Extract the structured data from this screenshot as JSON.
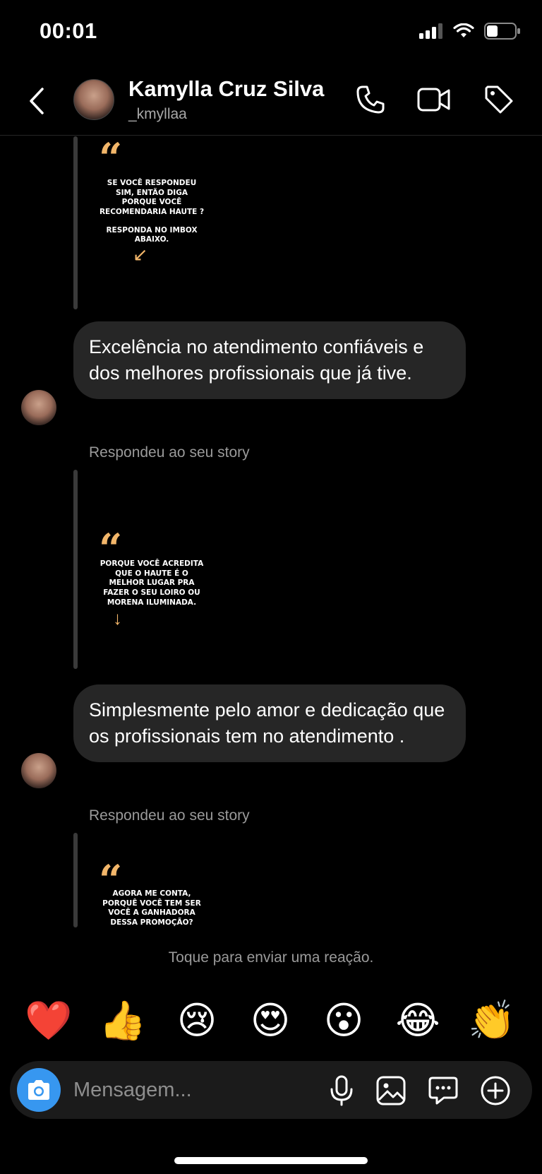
{
  "status_bar": {
    "time": "00:01",
    "battery_level": 0.35
  },
  "header": {
    "name": "Kamylla Cruz Silva",
    "username": "_kmyllaa"
  },
  "thread": {
    "story1": {
      "quote": "“",
      "text": "SE VOCÊ RESPONDEU SIM, ENTÃO DIGA PORQUE VOCÊ RECOMENDARIA HAUTE ?",
      "text2": "RESPONDA NO IMBOX ABAIXO."
    },
    "message1": "Excelência no atendimento confiáveis e dos melhores profissionais que já tive.",
    "replied_label_1": "Respondeu ao seu story",
    "story2": {
      "quote": "“",
      "text": "PORQUE VOCÊ ACREDITA QUE O HAUTE É O MELHOR LUGAR PRA FAZER O SEU LOIRO OU MORENA ILUMINADA."
    },
    "message2": "Simplesmente pelo amor e dedicação que os profissionais tem no atendimento .",
    "replied_label_2": "Respondeu ao seu story",
    "story3": {
      "quote": "“",
      "text": "AGORA ME CONTA, PORQUÊ VOCÊ TEM SER VOCÊ A GANHADORA DESSA PROMOÇÃO?"
    }
  },
  "tap_reaction": "Toque para enviar uma reação.",
  "reactions": [
    "❤️",
    "👍",
    "😢",
    "😍",
    "😮",
    "😂",
    "👏"
  ],
  "composer": {
    "placeholder": "Mensagem..."
  },
  "colors": {
    "accent": "#3797f0",
    "bubble": "#262626",
    "story_accent": "#f2b66a"
  }
}
